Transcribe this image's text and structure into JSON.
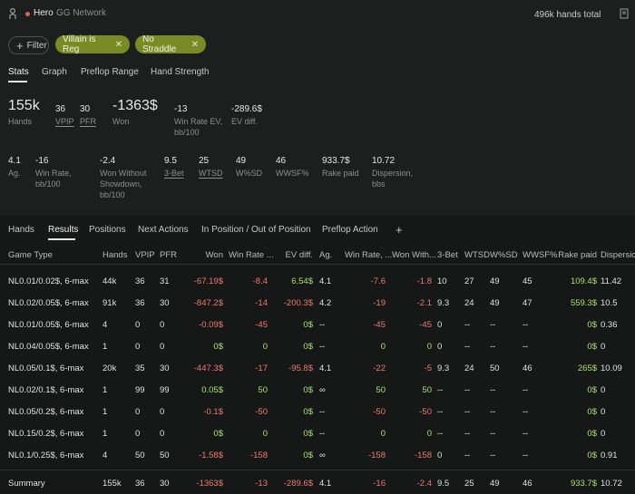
{
  "header": {
    "hero": "Hero",
    "network": "GG Network",
    "hands_total": "496k hands total",
    "accent_red": "#e0604f"
  },
  "filters": {
    "filter_label": "Filter",
    "tags": [
      "Villain is Reg",
      "No Straddle"
    ],
    "tag_color": "#7a8a24"
  },
  "stat_tabs": [
    "Stats",
    "Graph",
    "Preflop Range",
    "Hand Strength"
  ],
  "stats_row1": {
    "hands_value": "155k",
    "hands_label": "Hands",
    "vpip_value": "36",
    "vpip_label": "VPIP",
    "pfr_value": "30",
    "pfr_label": "PFR",
    "won_value": "-1363$",
    "won_label": "Won",
    "winrate_ev_value": "-13",
    "winrate_ev_label": "Win Rate EV, bb/100",
    "ev_diff_value": "-289.6$",
    "ev_diff_label": "EV diff."
  },
  "stats_row2": [
    {
      "value": "4.1",
      "label": "Ag.",
      "tone": "normal"
    },
    {
      "value": "-16",
      "label": "Win Rate, bb/100",
      "tone": "red"
    },
    {
      "value": "-2.4",
      "label": "Won Without Showdown, bb/100",
      "tone": "red"
    },
    {
      "value": "9.5",
      "label": "3-Bet",
      "tone": "normal"
    },
    {
      "value": "25",
      "label": "WTSD",
      "tone": "normal"
    },
    {
      "value": "49",
      "label": "W%SD",
      "tone": "normal"
    },
    {
      "value": "46",
      "label": "WWSF%",
      "tone": "normal"
    },
    {
      "value": "933.7$",
      "label": "Rake paid",
      "tone": "green"
    },
    {
      "value": "10.72",
      "label": "Dispersion, bbs",
      "tone": "normal"
    }
  ],
  "result_tabs": [
    "Hands",
    "Results",
    "Positions",
    "Next Actions",
    "In Position / Out of Position",
    "Preflop Action"
  ],
  "add_tab": "+",
  "table": {
    "columns": [
      "Game Type",
      "Hands",
      "VPIP",
      "PFR",
      "Won",
      "Win Rate ...",
      "EV diff.",
      "Ag.",
      "Win Rate, ...",
      "Won With...",
      "3-Bet",
      "WTSD",
      "W%SD",
      "WWSF%",
      "Rake paid",
      "Dispersio..."
    ],
    "rows": [
      [
        "NL0.01/0.02$, 6-max",
        "44k",
        "36",
        "31",
        "-67.19$",
        "-8.4",
        "6.54$",
        "4.1",
        "-7.6",
        "-1.8",
        "10",
        "27",
        "49",
        "45",
        "109.4$",
        "11.42"
      ],
      [
        "NL0.02/0.05$, 6-max",
        "91k",
        "36",
        "30",
        "-847.2$",
        "-14",
        "-200.3$",
        "4.2",
        "-19",
        "-2.1",
        "9.3",
        "24",
        "49",
        "47",
        "559.3$",
        "10.5"
      ],
      [
        "NL0.01/0.05$, 6-max",
        "4",
        "0",
        "0",
        "-0.09$",
        "-45",
        "0$",
        "--",
        "-45",
        "-45",
        "0",
        "--",
        "--",
        "--",
        "0$",
        "0.36"
      ],
      [
        "NL0.04/0.05$, 6-max",
        "1",
        "0",
        "0",
        "0$",
        "0",
        "0$",
        "--",
        "0",
        "0",
        "0",
        "--",
        "--",
        "--",
        "0$",
        "0"
      ],
      [
        "NL0.05/0.1$, 6-max",
        "20k",
        "35",
        "30",
        "-447.3$",
        "-17",
        "-95.8$",
        "4.1",
        "-22",
        "-5",
        "9.3",
        "24",
        "50",
        "46",
        "265$",
        "10.09"
      ],
      [
        "NL0.02/0.1$, 6-max",
        "1",
        "99",
        "99",
        "0.05$",
        "50",
        "0$",
        "∞",
        "50",
        "50",
        "--",
        "--",
        "--",
        "--",
        "0$",
        "0"
      ],
      [
        "NL0.05/0.2$, 6-max",
        "1",
        "0",
        "0",
        "-0.1$",
        "-50",
        "0$",
        "--",
        "-50",
        "-50",
        "--",
        "--",
        "--",
        "--",
        "0$",
        "0"
      ],
      [
        "NL0.15/0.2$, 6-max",
        "1",
        "0",
        "0",
        "0$",
        "0",
        "0$",
        "--",
        "0",
        "0",
        "--",
        "--",
        "--",
        "--",
        "0$",
        "0"
      ],
      [
        "NL0.1/0.25$, 6-max",
        "4",
        "50",
        "50",
        "-1.58$",
        "-158",
        "0$",
        "∞",
        "-158",
        "-158",
        "0",
        "--",
        "--",
        "--",
        "0$",
        "0.91"
      ]
    ],
    "summary": [
      "Summary",
      "155k",
      "36",
      "30",
      "-1363$",
      "-13",
      "-289.6$",
      "4.1",
      "-16",
      "-2.4",
      "9.5",
      "25",
      "49",
      "46",
      "933.7$",
      "10.72"
    ]
  },
  "colors": {
    "negative": "#ec7a6a",
    "positive": "#a7e06b"
  }
}
